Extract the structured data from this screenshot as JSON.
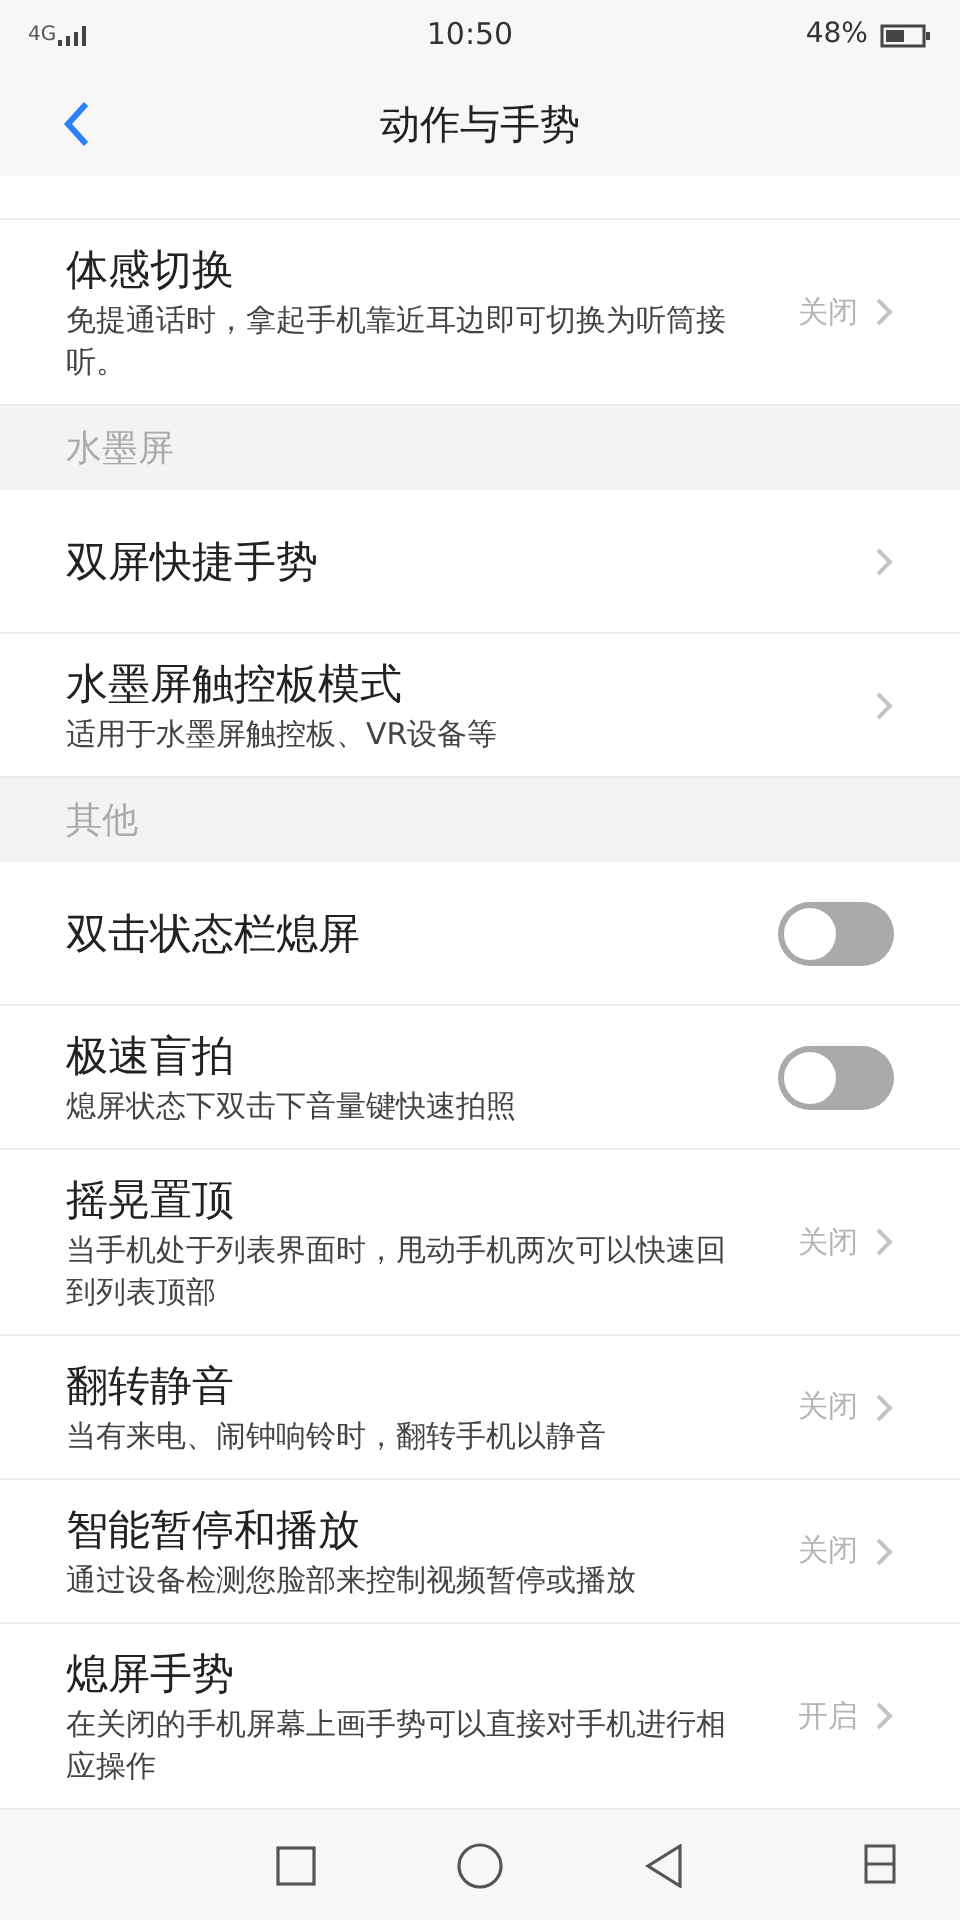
{
  "status_bar": {
    "network": "4G",
    "time": "10:50",
    "battery": "48%"
  },
  "header": {
    "title": "动作与手势"
  },
  "sections": [
    {
      "items": [
        {
          "kind": "value",
          "title": "体感切换",
          "subtitle": "免提通话时，拿起手机靠近耳边即可切换为听筒接听。",
          "value": "关闭"
        }
      ]
    },
    {
      "header": "水墨屏",
      "items": [
        {
          "kind": "link",
          "title": "双屏快捷手势"
        },
        {
          "kind": "link",
          "title": "水墨屏触控板模式",
          "subtitle": "适用于水墨屏触控板、VR设备等"
        }
      ]
    },
    {
      "header": "其他",
      "items": [
        {
          "kind": "toggle",
          "title": "双击状态栏熄屏",
          "on": false
        },
        {
          "kind": "toggle",
          "title": "极速盲拍",
          "subtitle": "熄屏状态下双击下音量键快速拍照",
          "on": false
        },
        {
          "kind": "value",
          "title": "摇晃置顶",
          "subtitle": "当手机处于列表界面时，甩动手机两次可以快速回到列表顶部",
          "value": "关闭"
        },
        {
          "kind": "value",
          "title": "翻转静音",
          "subtitle": "当有来电、闹钟响铃时，翻转手机以静音",
          "value": "关闭"
        },
        {
          "kind": "value",
          "title": "智能暂停和播放",
          "subtitle": "通过设备检测您脸部来控制视频暂停或播放",
          "value": "关闭"
        },
        {
          "kind": "value",
          "title": "熄屏手势",
          "subtitle": "在关闭的手机屏幕上画手势可以直接对手机进行相应操作",
          "value": "开启"
        }
      ]
    }
  ]
}
